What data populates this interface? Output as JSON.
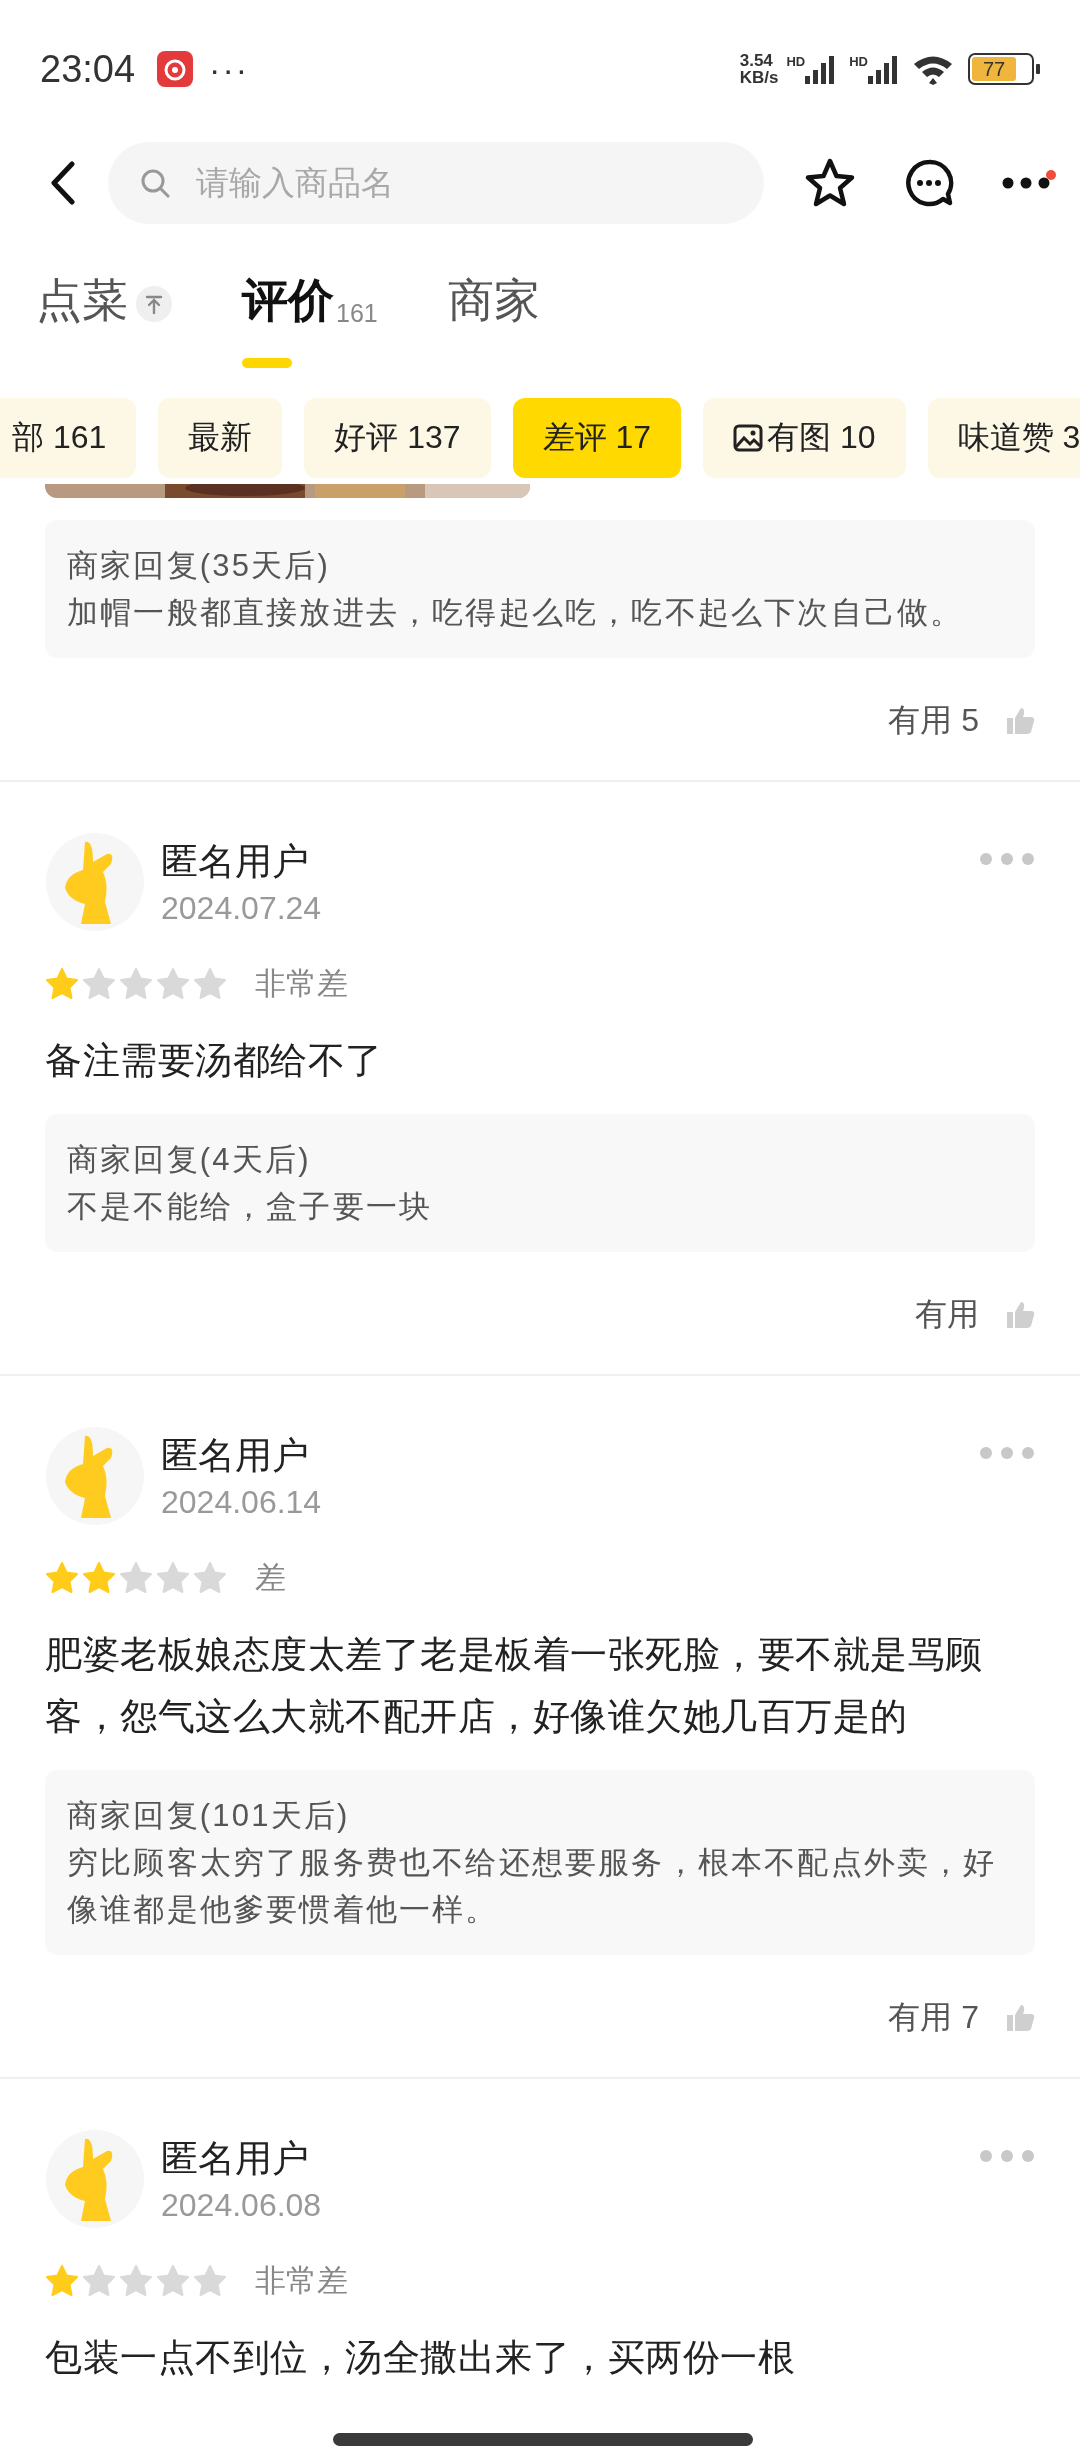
{
  "status_bar": {
    "time": "23:04",
    "more": "···",
    "speed_value": "3.54",
    "speed_unit": "KB/s",
    "sim_labels": [
      "HD",
      "HD"
    ],
    "battery": "77"
  },
  "nav": {
    "search": {
      "placeholder": "请输入商品名"
    }
  },
  "tabs": [
    {
      "label": "点菜",
      "selected": false
    },
    {
      "label": "评价",
      "count": "161",
      "selected": true
    },
    {
      "label": "商家",
      "selected": false
    }
  ],
  "filters": [
    {
      "label": "部 161",
      "selected": false
    },
    {
      "label": "最新",
      "selected": false
    },
    {
      "label": "好评 137",
      "selected": false
    },
    {
      "label": "差评 17",
      "selected": true
    },
    {
      "label": "有图 10",
      "selected": false
    },
    {
      "label": "味道赞 3",
      "selected": false
    }
  ],
  "reviews": [
    {
      "kind": "partial",
      "reply": {
        "title": "商家回复(35天后)",
        "text": "加帽一般都直接放进去，吃得起么吃，吃不起么下次自己做。"
      },
      "helpful": "有用 5"
    },
    {
      "kind": "full",
      "user": "匿名用户",
      "date": "2024.07.24",
      "stars": 1,
      "rating_label": "非常差",
      "text": "备注需要汤都给不了",
      "reply": {
        "title": "商家回复(4天后)",
        "text": "不是不能给，盒子要一块"
      },
      "helpful": "有用"
    },
    {
      "kind": "full",
      "user": "匿名用户",
      "date": "2024.06.14",
      "stars": 2,
      "rating_label": "差",
      "text": "肥婆老板娘态度太差了老是板着一张死脸，要不就是骂顾客，怨气这么大就不配开店，好像谁欠她几百万是的",
      "reply": {
        "title": "商家回复(101天后)",
        "text": "穷比顾客太穷了服务费也不给还想要服务，根本不配点外卖，好像谁都是他爹要惯着他一样。"
      },
      "helpful": "有用 7"
    },
    {
      "kind": "full",
      "user": "匿名用户",
      "date": "2024.06.08",
      "stars": 1,
      "rating_label": "非常差",
      "text": "包装一点不到位，汤全撒出来了，买两份一根"
    }
  ]
}
